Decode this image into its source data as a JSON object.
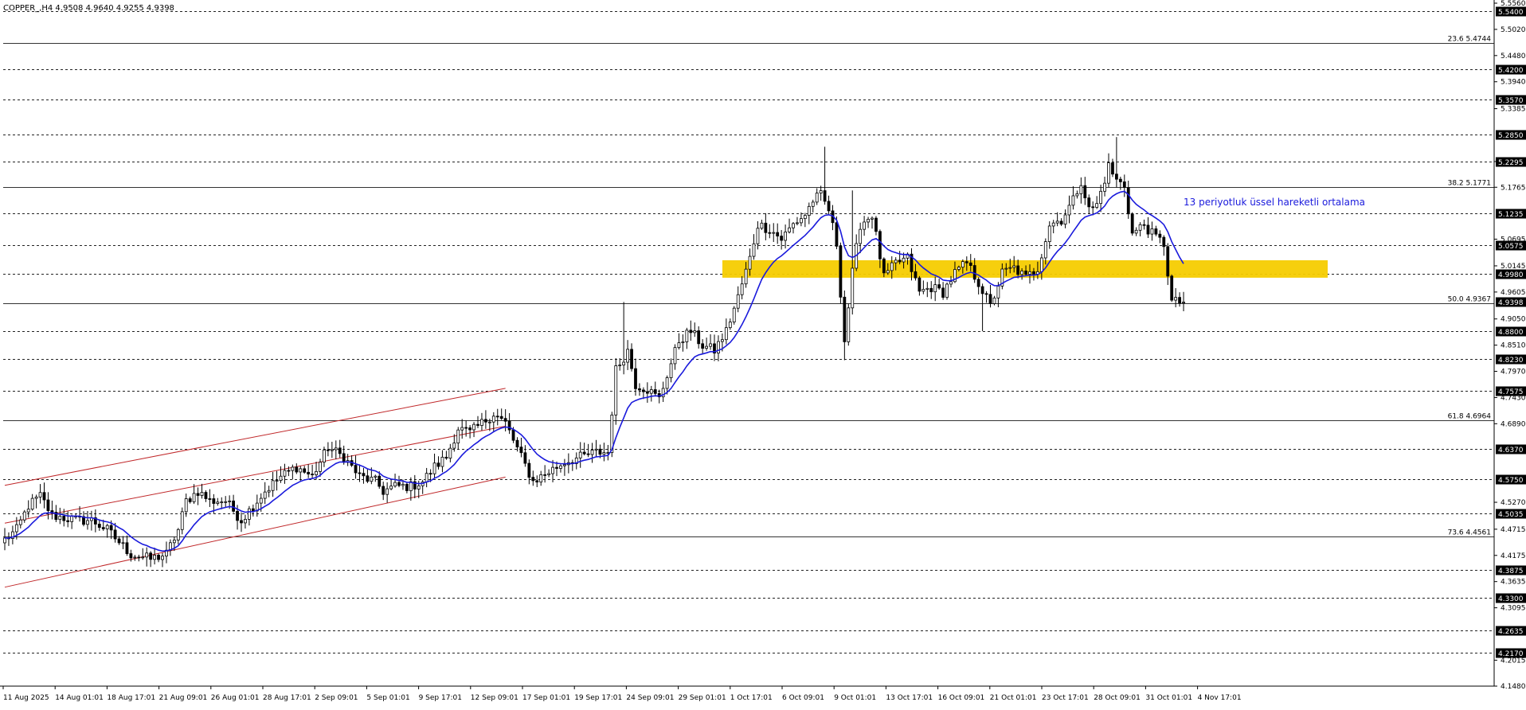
{
  "header": {
    "symbol_line": "COPPER_,H4  4.9508 4.9640 4.9255 4.9398"
  },
  "chart_data": {
    "type": "candlestick",
    "symbol": "COPPER_",
    "timeframe": "H4",
    "ylim": [
      4.148,
      5.556
    ],
    "grid": false,
    "y_ticks": [
      "5.5560",
      "5.5020",
      "5.4480",
      "5.3940",
      "5.3385",
      "5.2295",
      "5.1765",
      "5.0695",
      "5.0145",
      "4.9605",
      "4.9050",
      "4.8510",
      "4.7970",
      "4.7430",
      "4.6890",
      "4.5270",
      "4.4715",
      "4.4175",
      "4.3635",
      "4.3095",
      "4.2015",
      "4.1480"
    ],
    "x_labels": [
      "11 Aug 2025",
      "14 Aug 01:01",
      "18 Aug 17:01",
      "21 Aug 09:01",
      "26 Aug 01:01",
      "28 Aug 17:01",
      "2 Sep 09:01",
      "5 Sep 01:01",
      "9 Sep 17:01",
      "12 Sep 09:01",
      "17 Sep 01:01",
      "19 Sep 17:01",
      "24 Sep 09:01",
      "29 Sep 01:01",
      "1 Oct 17:01",
      "6 Oct 09:01",
      "9 Oct 01:01",
      "13 Oct 17:01",
      "16 Oct 09:01",
      "21 Oct 01:01",
      "23 Oct 17:01",
      "28 Oct 09:01",
      "31 Oct 01:01",
      "4 Nov 17:01"
    ],
    "horizontal_levels": [
      {
        "price": 5.54,
        "label": "5.5400",
        "style": "dashed"
      },
      {
        "price": 5.42,
        "label": "5.4200",
        "style": "dashed"
      },
      {
        "price": 5.357,
        "label": "5.3570",
        "style": "dashed"
      },
      {
        "price": 5.285,
        "label": "5.2850",
        "style": "dashed"
      },
      {
        "price": 5.2295,
        "label": "5.2295",
        "style": "dashed"
      },
      {
        "price": 5.1235,
        "label": "5.1235",
        "style": "dashed"
      },
      {
        "price": 5.0575,
        "label": "5.0575",
        "style": "dashed"
      },
      {
        "price": 4.998,
        "label": "4.9980",
        "style": "dashed"
      },
      {
        "price": 4.88,
        "label": "4.8800",
        "style": "dashed"
      },
      {
        "price": 4.823,
        "label": "4.8230",
        "style": "dashed"
      },
      {
        "price": 4.7575,
        "label": "4.7575",
        "style": "dashed"
      },
      {
        "price": 4.637,
        "label": "4.6370",
        "style": "dashed"
      },
      {
        "price": 4.575,
        "label": "4.5750",
        "style": "dashed"
      },
      {
        "price": 4.5035,
        "label": "4.5035",
        "style": "dashed"
      },
      {
        "price": 4.3875,
        "label": "4.3875",
        "style": "dashed"
      },
      {
        "price": 4.33,
        "label": "4.3300",
        "style": "dashed"
      },
      {
        "price": 4.2635,
        "label": "4.2635",
        "style": "dashed"
      },
      {
        "price": 4.217,
        "label": "4.2170",
        "style": "dashed"
      }
    ],
    "fibonacci_levels": [
      {
        "price": 5.4744,
        "label": "23.6 5.4744"
      },
      {
        "price": 5.1771,
        "label": "38.2 5.1771"
      },
      {
        "price": 4.9367,
        "label": "50.0 4.9367"
      },
      {
        "price": 4.6964,
        "label": "61.8 4.6964"
      },
      {
        "price": 4.4561,
        "label": "73.6 4.4561"
      }
    ],
    "current_price": {
      "price": 4.9398,
      "label": "4.9398"
    },
    "zone": {
      "from": 4.99,
      "to": 5.026,
      "color": "#f5cc00"
    },
    "annotation": {
      "text": "13 periyotluk üssel hareketli ortalama",
      "color": "#1a1adc"
    },
    "channel_color": "#c0282a",
    "ema_color": "#1a1adc",
    "ema_period": 13,
    "anchors": [
      {
        "t": 0,
        "p": 4.45
      },
      {
        "t": 3,
        "p": 4.47
      },
      {
        "t": 6,
        "p": 4.52
      },
      {
        "t": 9,
        "p": 4.54
      },
      {
        "t": 12,
        "p": 4.5
      },
      {
        "t": 18,
        "p": 4.49
      },
      {
        "t": 22,
        "p": 4.49
      },
      {
        "t": 26,
        "p": 4.47
      },
      {
        "t": 32,
        "p": 4.42
      },
      {
        "t": 37,
        "p": 4.41
      },
      {
        "t": 41,
        "p": 4.42
      },
      {
        "t": 44,
        "p": 4.47
      },
      {
        "t": 46,
        "p": 4.53
      },
      {
        "t": 49,
        "p": 4.55
      },
      {
        "t": 52,
        "p": 4.53
      },
      {
        "t": 56,
        "p": 4.53
      },
      {
        "t": 60,
        "p": 4.49
      },
      {
        "t": 63,
        "p": 4.52
      },
      {
        "t": 66,
        "p": 4.55
      },
      {
        "t": 70,
        "p": 4.58
      },
      {
        "t": 74,
        "p": 4.6
      },
      {
        "t": 78,
        "p": 4.58
      },
      {
        "t": 82,
        "p": 4.64
      },
      {
        "t": 86,
        "p": 4.62
      },
      {
        "t": 90,
        "p": 4.58
      },
      {
        "t": 94,
        "p": 4.57
      },
      {
        "t": 96,
        "p": 4.55
      },
      {
        "t": 99,
        "p": 4.56
      },
      {
        "t": 103,
        "p": 4.56
      },
      {
        "t": 106,
        "p": 4.57
      },
      {
        "t": 109,
        "p": 4.6
      },
      {
        "t": 112,
        "p": 4.62
      },
      {
        "t": 115,
        "p": 4.68
      },
      {
        "t": 118,
        "p": 4.67
      },
      {
        "t": 121,
        "p": 4.69
      },
      {
        "t": 124,
        "p": 4.71
      },
      {
        "t": 127,
        "p": 4.69
      },
      {
        "t": 131,
        "p": 4.62
      },
      {
        "t": 134,
        "p": 4.57
      },
      {
        "t": 138,
        "p": 4.59
      },
      {
        "t": 142,
        "p": 4.61
      },
      {
        "t": 146,
        "p": 4.62
      },
      {
        "t": 150,
        "p": 4.63
      },
      {
        "t": 153,
        "p": 4.63
      },
      {
        "t": 155,
        "p": 4.8
      },
      {
        "t": 158,
        "p": 4.84
      },
      {
        "t": 160,
        "p": 4.77
      },
      {
        "t": 163,
        "p": 4.76
      },
      {
        "t": 166,
        "p": 4.74
      },
      {
        "t": 168,
        "p": 4.79
      },
      {
        "t": 171,
        "p": 4.86
      },
      {
        "t": 174,
        "p": 4.88
      },
      {
        "t": 177,
        "p": 4.85
      },
      {
        "t": 180,
        "p": 4.84
      },
      {
        "t": 183,
        "p": 4.88
      },
      {
        "t": 186,
        "p": 4.95
      },
      {
        "t": 189,
        "p": 5.03
      },
      {
        "t": 191,
        "p": 5.1
      },
      {
        "t": 194,
        "p": 5.09
      },
      {
        "t": 197,
        "p": 5.07
      },
      {
        "t": 200,
        "p": 5.1
      },
      {
        "t": 203,
        "p": 5.12
      },
      {
        "t": 205,
        "p": 5.15
      },
      {
        "t": 207,
        "p": 5.16
      },
      {
        "t": 209,
        "p": 5.13
      },
      {
        "t": 211,
        "p": 5.06
      },
      {
        "t": 213,
        "p": 4.86
      },
      {
        "t": 215,
        "p": 5.0
      },
      {
        "t": 217,
        "p": 5.1
      },
      {
        "t": 220,
        "p": 5.12
      },
      {
        "t": 223,
        "p": 4.99
      },
      {
        "t": 226,
        "p": 5.02
      },
      {
        "t": 229,
        "p": 5.03
      },
      {
        "t": 232,
        "p": 4.96
      },
      {
        "t": 235,
        "p": 4.97
      },
      {
        "t": 238,
        "p": 4.96
      },
      {
        "t": 241,
        "p": 5.0
      },
      {
        "t": 244,
        "p": 5.02
      },
      {
        "t": 247,
        "p": 4.98
      },
      {
        "t": 250,
        "p": 4.93
      },
      {
        "t": 253,
        "p": 5.0
      },
      {
        "t": 256,
        "p": 5.01
      },
      {
        "t": 259,
        "p": 4.99
      },
      {
        "t": 262,
        "p": 5.01
      },
      {
        "t": 265,
        "p": 5.1
      },
      {
        "t": 268,
        "p": 5.11
      },
      {
        "t": 271,
        "p": 5.15
      },
      {
        "t": 273,
        "p": 5.19
      },
      {
        "t": 275,
        "p": 5.13
      },
      {
        "t": 277,
        "p": 5.14
      },
      {
        "t": 280,
        "p": 5.22
      },
      {
        "t": 282,
        "p": 5.19
      },
      {
        "t": 284,
        "p": 5.18
      },
      {
        "t": 286,
        "p": 5.08
      },
      {
        "t": 289,
        "p": 5.1
      },
      {
        "t": 291,
        "p": 5.08
      },
      {
        "t": 294,
        "p": 5.06
      },
      {
        "t": 296,
        "p": 4.94
      },
      {
        "t": 298,
        "p": 4.94
      },
      {
        "t": 299,
        "p": 4.94
      }
    ]
  }
}
